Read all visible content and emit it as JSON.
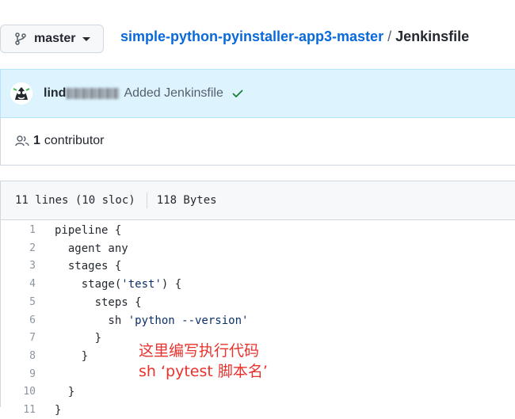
{
  "branch": {
    "label": "master"
  },
  "breadcrumb": {
    "repo": "simple-python-pyinstaller-app3-master",
    "separator": "/",
    "file": "Jenkinsfile"
  },
  "commit": {
    "author_visible": "lind",
    "message": "Added Jenkinsfile",
    "status": "success",
    "status_color": "#1a7f37"
  },
  "contributors": {
    "count": "1",
    "label": "contributor"
  },
  "file_info": {
    "lines": "11 lines (10 sloc)",
    "size": "118 Bytes"
  },
  "code_lines": [
    {
      "num": "1",
      "indent": "",
      "text": "pipeline {"
    },
    {
      "num": "2",
      "indent": "  ",
      "text": "agent any"
    },
    {
      "num": "3",
      "indent": "  ",
      "text": "stages {"
    },
    {
      "num": "4",
      "indent": "    ",
      "text": "stage(",
      "str": "'test'",
      "after": ") {"
    },
    {
      "num": "5",
      "indent": "      ",
      "text": "steps {"
    },
    {
      "num": "6",
      "indent": "        ",
      "text": "sh ",
      "str": "'python --version'",
      "after": ""
    },
    {
      "num": "7",
      "indent": "      ",
      "text": "}"
    },
    {
      "num": "8",
      "indent": "    ",
      "text": "}"
    },
    {
      "num": "9",
      "indent": "",
      "text": ""
    },
    {
      "num": "10",
      "indent": "  ",
      "text": "}"
    },
    {
      "num": "11",
      "indent": "",
      "text": "}"
    }
  ],
  "annotation": {
    "line1": "这里编写执行代码",
    "line2": "sh ‘pytest 脚本名’",
    "color": "#e8322d"
  },
  "colors": {
    "link": "#0969da",
    "commit_bg": "#ddf4ff",
    "border": "#d0d7de"
  }
}
